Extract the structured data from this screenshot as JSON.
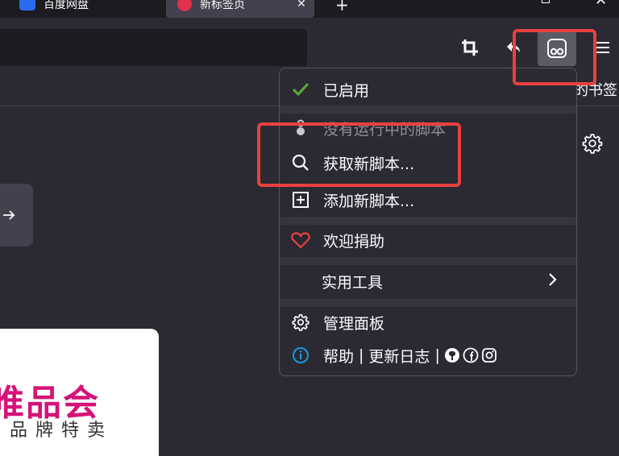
{
  "tabs": [
    {
      "title": "百度网盘",
      "favicon": "baidu-netdisk-icon"
    },
    {
      "title": "新标签页",
      "favicon": "firefox-newtab-icon",
      "active": true
    }
  ],
  "bookmarks_overflow_text": "的书签",
  "toolbar": {
    "icons": [
      "crop-icon",
      "undo-icon",
      "tampermonkey-icon",
      "hamburger-menu-icon"
    ]
  },
  "popup": {
    "enabled_label": "已启用",
    "no_scripts_label": "没有运行中的脚本",
    "get_scripts_label": "获取新脚本...",
    "add_script_label": "添加新脚本...",
    "donate_label": "欢迎捐助",
    "utilities_label": "实用工具",
    "dashboard_label": "管理面板",
    "help_label": "帮助",
    "changelog_label": "更新日志",
    "separator": "|"
  },
  "shortcut": {
    "name": "唯品会",
    "subtitle": "品牌特卖"
  },
  "colors": {
    "accent_check": "#5aad3b",
    "heart": "#e8423f",
    "info": "#1a9ae0",
    "highlight": "#e8423f",
    "vip_brand": "#d5137a"
  }
}
